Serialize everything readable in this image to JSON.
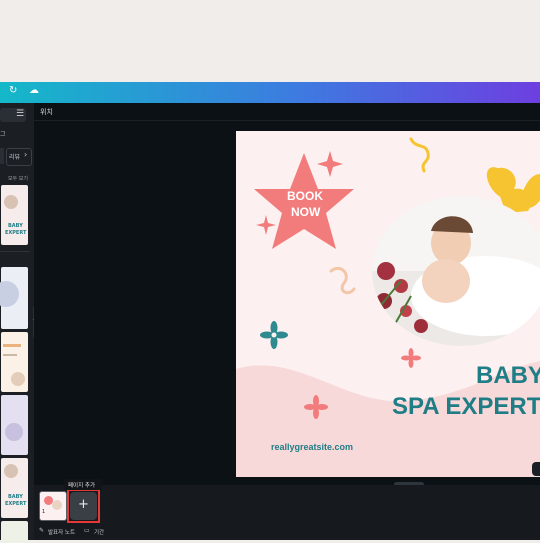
{
  "topbar": {
    "redo_icon": "redo-icon",
    "cloud_icon": "cloud-sync-icon"
  },
  "left_panel": {
    "filter_icon": "sliders-icon",
    "section_label": "그",
    "tab_label": "리뷰",
    "see_all": "모두 보기",
    "thumb_text": "BABY\nSPA EXPERT",
    "thumb_texts": [
      "BABY",
      "SPA",
      "EXPERT"
    ]
  },
  "workspace": {
    "page_label": "위치"
  },
  "design": {
    "book_now_line1": "BOOK",
    "book_now_line2": "NOW",
    "title_line1": "BABY",
    "title_line2": "SPA EXPERT",
    "website": "reallygreatsite.com",
    "colors": {
      "coral": "#f27b7b",
      "teal": "#1f7d86",
      "yellow": "#f6c431",
      "bg": "#fdf0f0",
      "wave": "#f8d9d9"
    }
  },
  "bottom": {
    "tooltip": "페이지 추가",
    "add_page_symbol": "+",
    "page_number": "1",
    "notes_label": "발표자 노트",
    "timer_label": "기간"
  }
}
